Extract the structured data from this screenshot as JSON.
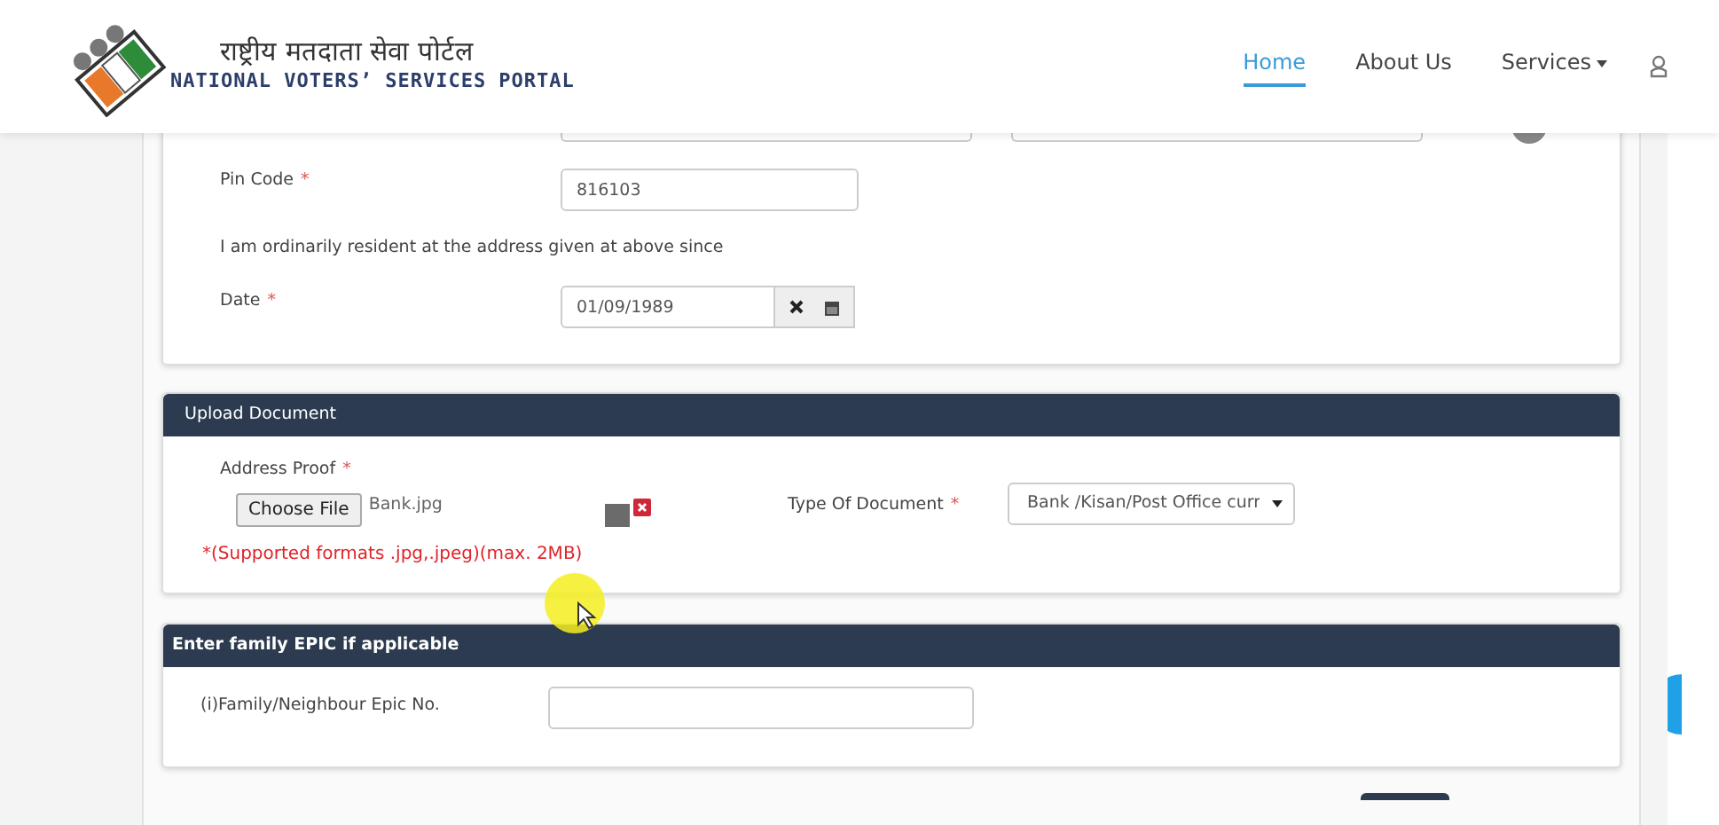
{
  "header": {
    "title_hindi": "राष्ट्रीय मतदाता सेवा पोर्टल",
    "title_english": "NATIONAL VOTERS’ SERVICES PORTAL"
  },
  "nav": [
    {
      "label": "Home",
      "selected": true,
      "kind": "link"
    },
    {
      "label": "About Us",
      "selected": false,
      "kind": "link"
    },
    {
      "label": "Services",
      "selected": false,
      "kind": "dropdown"
    }
  ],
  "address_section": {
    "pin_code": {
      "label": "Pin Code",
      "required_mark": "*",
      "value": "816103"
    },
    "resident_since_text": "I am ordinarily resident at the address given at above since",
    "date": {
      "label": "Date",
      "required_mark": "*",
      "value": "01/09/1989"
    }
  },
  "upload_section": {
    "title": "Upload Document",
    "address_proof": {
      "label": "Address Proof",
      "required_mark": "*",
      "button": "Choose File",
      "file_name": "Bank.jpg"
    },
    "note": "*(Supported formats .jpg,.jpeg)(max. 2MB)",
    "type_of_document": {
      "label": "Type Of Document",
      "required_mark": "*",
      "value": "Bank /Kisan/Post Office curr"
    }
  },
  "epic_section": {
    "title": "Enter family EPIC if applicable",
    "field": {
      "label": "(i)Family/Neighbour Epic No."
    }
  }
}
